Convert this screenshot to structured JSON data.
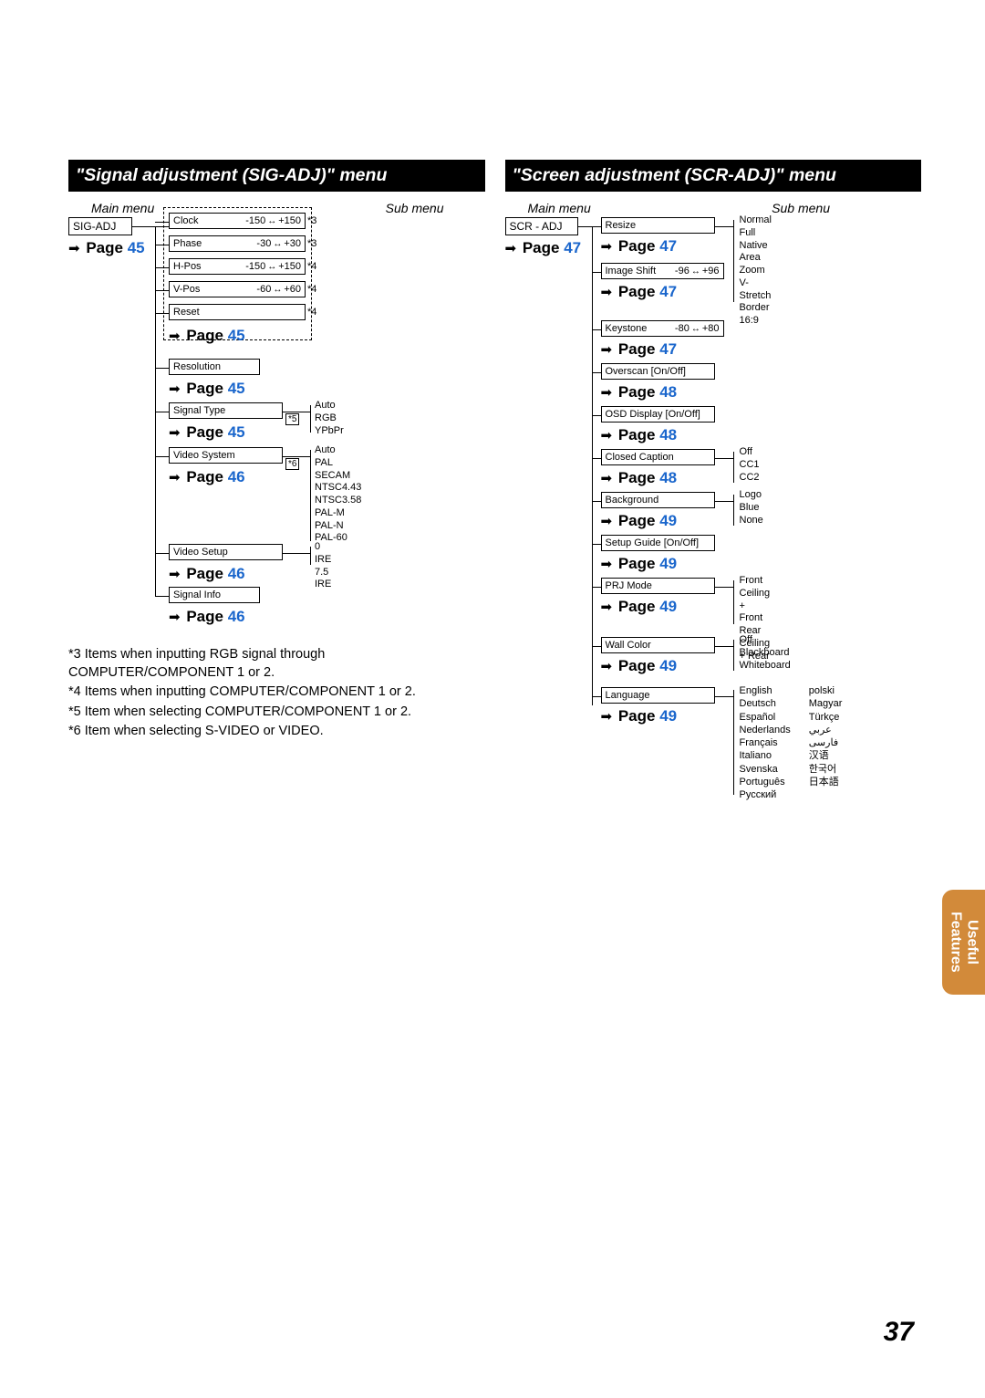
{
  "page_number": "37",
  "side_tab": {
    "line1": "Useful",
    "line2": "Features"
  },
  "left": {
    "title": "\"Signal adjustment (SIG-ADJ)\" menu",
    "main_label": "Main menu",
    "sub_label": "Sub menu",
    "main_box": "SIG-ADJ",
    "page_ref_main": "Page",
    "page_ref_main_num": "45",
    "group1": [
      {
        "name": "Clock",
        "lo": "-150",
        "hi": "+150",
        "note": "*3"
      },
      {
        "name": "Phase",
        "lo": "-30",
        "hi": "+30",
        "note": "*3"
      },
      {
        "name": "H-Pos",
        "lo": "-150",
        "hi": "+150",
        "note": "*4"
      },
      {
        "name": "V-Pos",
        "lo": "-60",
        "hi": "+60",
        "note": "*4"
      },
      {
        "name": "Reset",
        "lo": "",
        "hi": "",
        "note": "*4"
      }
    ],
    "group1_ref": "Page",
    "group1_ref_num": "45",
    "resolution": {
      "name": "Resolution",
      "ref": "Page",
      "ref_num": "45"
    },
    "signal_type": {
      "name": "Signal Type",
      "note": "*5",
      "ref": "Page",
      "ref_num": "45",
      "sub": [
        "Auto",
        "RGB",
        "YPbPr"
      ]
    },
    "video_system": {
      "name": "Video System",
      "note": "*6",
      "ref": "Page",
      "ref_num": "46",
      "sub": [
        "Auto",
        "PAL",
        "SECAM",
        "NTSC4.43",
        "NTSC3.58",
        "PAL-M",
        "PAL-N",
        "PAL-60"
      ]
    },
    "video_setup": {
      "name": "Video Setup",
      "ref": "Page",
      "ref_num": "46",
      "sub": [
        "0 IRE",
        "7.5 IRE"
      ]
    },
    "signal_info": {
      "name": "Signal Info",
      "ref": "Page",
      "ref_num": "46"
    },
    "notes": [
      "*3 Items when inputting RGB signal through COMPUTER/COMPONENT 1 or 2.",
      "*4 Items when inputting COMPUTER/COMPONENT 1 or 2.",
      "*5 Item when selecting COMPUTER/COMPONENT 1 or 2.",
      "*6 Item when selecting S-VIDEO or VIDEO."
    ]
  },
  "right": {
    "title": "\"Screen adjustment (SCR-ADJ)\" menu",
    "main_label": "Main menu",
    "sub_label": "Sub menu",
    "main_box": "SCR - ADJ",
    "page_ref_main": "Page",
    "page_ref_main_num": "47",
    "items": [
      {
        "name": "Resize",
        "ref": "Page",
        "ref_num": "47",
        "sub": [
          "Normal",
          "Full",
          "Native",
          "Area Zoom",
          "V-Stretch",
          "Border",
          "16:9"
        ]
      },
      {
        "name": "Image Shift",
        "lo": "-96",
        "hi": "+96",
        "ref": "Page",
        "ref_num": "47"
      },
      {
        "name": "Keystone",
        "lo": "-80",
        "hi": "+80",
        "ref": "Page",
        "ref_num": "47"
      },
      {
        "name": "Overscan [On/Off]",
        "ref": "Page",
        "ref_num": "48"
      },
      {
        "name": "OSD Display [On/Off]",
        "ref": "Page",
        "ref_num": "48"
      },
      {
        "name": "Closed Caption",
        "ref": "Page",
        "ref_num": "48",
        "sub": [
          "Off",
          "CC1",
          "CC2"
        ]
      },
      {
        "name": "Background",
        "ref": "Page",
        "ref_num": "49",
        "sub": [
          "Logo",
          "Blue",
          "None"
        ]
      },
      {
        "name": "Setup Guide [On/Off]",
        "ref": "Page",
        "ref_num": "49"
      },
      {
        "name": "PRJ Mode",
        "ref": "Page",
        "ref_num": "49",
        "sub": [
          "Front",
          "Ceiling + Front",
          "Rear",
          "Ceiling + Rear"
        ]
      },
      {
        "name": "Wall Color",
        "ref": "Page",
        "ref_num": "49",
        "sub": [
          "Off",
          "Blackboard",
          "Whiteboard"
        ]
      },
      {
        "name": "Language",
        "ref": "Page",
        "ref_num": "49",
        "langs_col1": [
          "English",
          "Deutsch",
          "Español",
          "Nederlands",
          "Français",
          "Italiano",
          "Svenska",
          "Português",
          "Русский"
        ],
        "langs_col2": [
          "polski",
          "Magyar",
          "Türkçe",
          "عربي",
          "فارسی",
          "汉语",
          "한국어",
          "日本語"
        ]
      }
    ]
  }
}
